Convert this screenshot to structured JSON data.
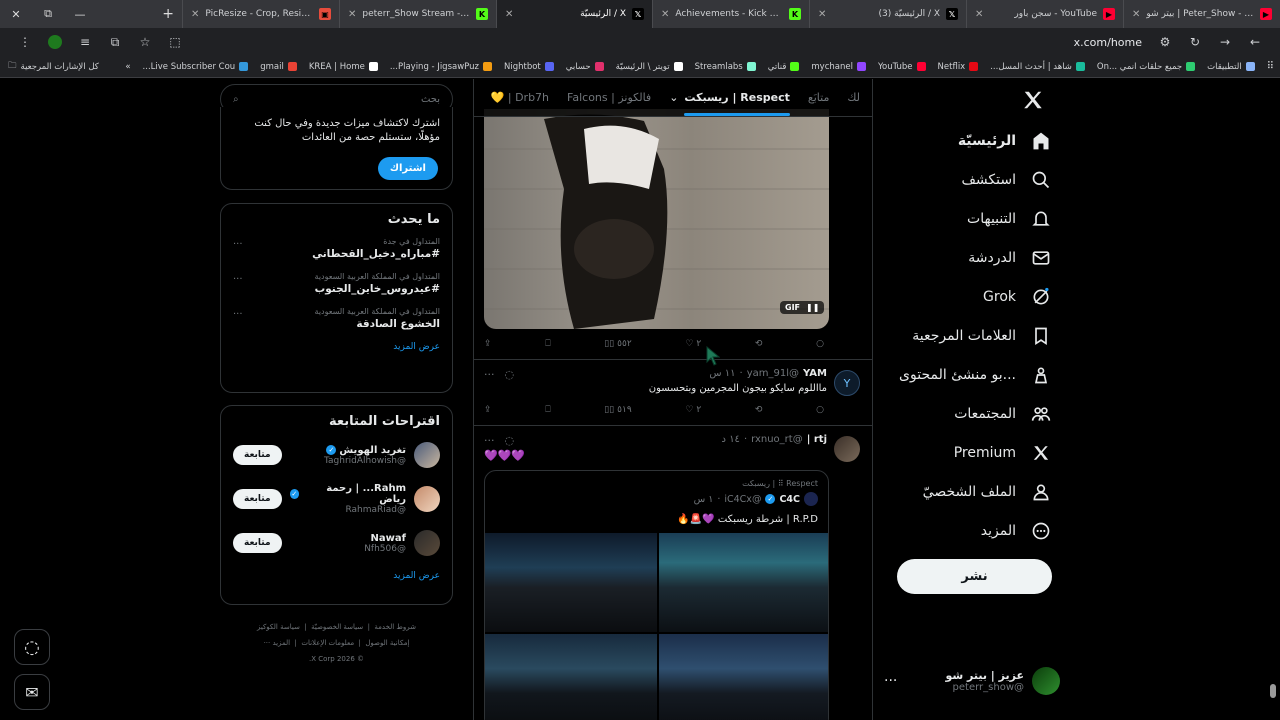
{
  "browser": {
    "tabs": [
      {
        "title": "بيتر شو | Peter_Show - YouTube",
        "icon": "youtube-icon",
        "color": "#ff0033"
      },
      {
        "title": "سجن باور - YouTube",
        "icon": "youtube-icon",
        "color": "#ff0033"
      },
      {
        "title": "(3) الرئيسيّة / X",
        "icon": "x-icon",
        "color": "#ffffff"
      },
      {
        "title": "Achievements - Kick Dashboard",
        "icon": "kick-icon",
        "color": "#53fc18"
      },
      {
        "title": "الرئيسيّة / X",
        "icon": "x-icon",
        "color": "#ffffff",
        "active": true
      },
      {
        "title": "peterr_Show Stream - Watch Li",
        "icon": "kick-icon",
        "color": "#53fc18"
      },
      {
        "title": "PicResize - Crop, Resize, Edit in",
        "icon": "picresize-icon",
        "color": "#e74c3c"
      }
    ],
    "url": "x.com/home",
    "bookmarks": [
      {
        "label": "التطبيقات",
        "color": "#8ab4f8"
      },
      {
        "label": "جميع حلقات انمي ...On",
        "color": "#2ecc71"
      },
      {
        "label": "شاهد | أحدث المسل...",
        "color": "#1abc9c"
      },
      {
        "label": "Netflix",
        "color": "#e50914"
      },
      {
        "label": "YouTube",
        "color": "#ff0033"
      },
      {
        "label": "mychanel",
        "color": "#9146ff"
      },
      {
        "label": "قناتي",
        "color": "#53fc18"
      },
      {
        "label": "Streamlabs",
        "color": "#80f5d2"
      },
      {
        "label": "تويتر \\ الرئيسيّة",
        "color": "#ffffff"
      },
      {
        "label": "حسابي",
        "color": "#e1306c"
      },
      {
        "label": "Nightbot",
        "color": "#5865f2"
      },
      {
        "label": "Playing - JigsawPuz...",
        "color": "#f39c12"
      },
      {
        "label": "KREA | Home",
        "color": "#ffffff"
      },
      {
        "label": "gmail",
        "color": "#ea4335"
      },
      {
        "label": "Live Subscriber Cou...",
        "color": "#3498db"
      }
    ],
    "all_bookmarks": "كل الإشارات المرجعية"
  },
  "nav": {
    "items": [
      {
        "label": "الرئيسيّة",
        "icon": "home-icon",
        "bold": true
      },
      {
        "label": "استكشف",
        "icon": "search-icon"
      },
      {
        "label": "التنبيهات",
        "icon": "bell-icon"
      },
      {
        "label": "الدردشة",
        "icon": "mail-icon"
      },
      {
        "label": "Grok",
        "icon": "grok-icon"
      },
      {
        "label": "العلامات المرجعية",
        "icon": "bookmark-icon"
      },
      {
        "label": "...بو منشئ المحتوى",
        "icon": "creator-icon"
      },
      {
        "label": "المجتمعات",
        "icon": "communities-icon"
      },
      {
        "label": "Premium",
        "icon": "x-icon"
      },
      {
        "label": "الملف الشخصيّ",
        "icon": "profile-icon"
      },
      {
        "label": "المزيد",
        "icon": "more-icon"
      }
    ],
    "post": "نشر",
    "account": {
      "name": "عزيز | بيتر شو",
      "handle": "@peterr_show"
    }
  },
  "timeline": {
    "tabs": [
      "لك",
      "متابَع",
      "Respect | ريسبكت",
      "فالكونز | Falcons",
      "Drb7h | 💛"
    ],
    "tweet1": {
      "gif_badge": "GIF",
      "views": "٥٥٢",
      "likes": "٢"
    },
    "tweet2": {
      "name": "YAM",
      "handle": "@yam_91l",
      "time": "١١ س",
      "text": "مااللوم سايكو بيجون المجرمين وبتحسسون",
      "views": "٥١٩",
      "likes": "٢"
    },
    "tweet3": {
      "name": "rtj |",
      "handle": "@rxnuo_rt",
      "time": "١٤ د",
      "text": "💜💜💜",
      "quote": {
        "community": "Respect | ريسبكت",
        "name": "C4C",
        "handle": "@iC4Cx",
        "time": "١ س",
        "text": "R.P.D | شرطة ريسبكت 💜🚨🔥"
      }
    }
  },
  "sidebar": {
    "search_placeholder": "بحث",
    "premium_text": "اشترك لاكتشاف ميزات جديدة وفي حال كنت مؤهلًا، ستستلم حصة من العائدات",
    "subscribe": "اشتراك",
    "trends_title": "ما يحدث",
    "trends": [
      {
        "context": "المتداول في جدة",
        "title": "#مباراه_دخيل_القحطاني"
      },
      {
        "context": "المتداول في المملكة العربية السعودية",
        "title": "#عيدروس_خاين_الجنوب"
      },
      {
        "context": "المتداول في المملكة العربية السعودية",
        "title": "الخشوع الصادقة"
      }
    ],
    "show_more": "عرض المزيد",
    "follow_title": "اقتراحات المتابعة",
    "suggestions": [
      {
        "name": "تغريد الهويش",
        "handle": "@TaghridAlhowish",
        "button": "متابعة",
        "verified": true
      },
      {
        "name": "Rahm... | رحمة رياض",
        "handle": "@RahmaRiad",
        "button": "متابعة",
        "verified": true
      },
      {
        "name": "Nawaf",
        "handle": "@Nfh506",
        "button": "متابعة",
        "verified": false
      }
    ],
    "footer": [
      "شروط الخدمة",
      "سياسة الخصوصيّة",
      "سياسة الكوكيز",
      "إمكانية الوصول",
      "معلومات الإعلانات",
      "المزيد ···",
      "© 2026 X Corp."
    ]
  }
}
